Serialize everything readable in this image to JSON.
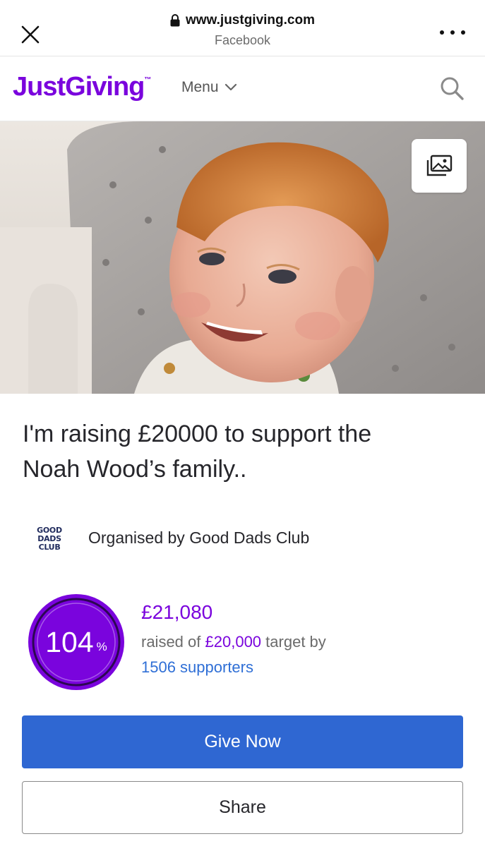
{
  "browser": {
    "url": "www.justgiving.com",
    "source": "Facebook"
  },
  "header": {
    "logo": "JustGiving",
    "logo_tm": "™",
    "menu_label": "Menu"
  },
  "page": {
    "title_line1": "I'm raising £20000 to support the",
    "title_line2": "Noah Wood’s family..",
    "organiser_logo_lines": [
      "GOOD",
      "DADS",
      "CLUB"
    ],
    "organiser_text": "Organised by Good Dads Club"
  },
  "progress": {
    "percent": "104",
    "percent_sign": "%",
    "percent_value": 104,
    "raised_amount": "£21,080",
    "raised_prefix": "raised of",
    "target_amount": "£20,000",
    "raised_suffix": "target by",
    "supporters": "1506 supporters"
  },
  "actions": {
    "give_label": "Give Now",
    "share_label": "Share"
  },
  "colors": {
    "brand_purple": "#7a04dd",
    "ring_purple": "#7a04dd",
    "give_blue": "#2f67d2",
    "link_blue": "#2f6fd6"
  }
}
